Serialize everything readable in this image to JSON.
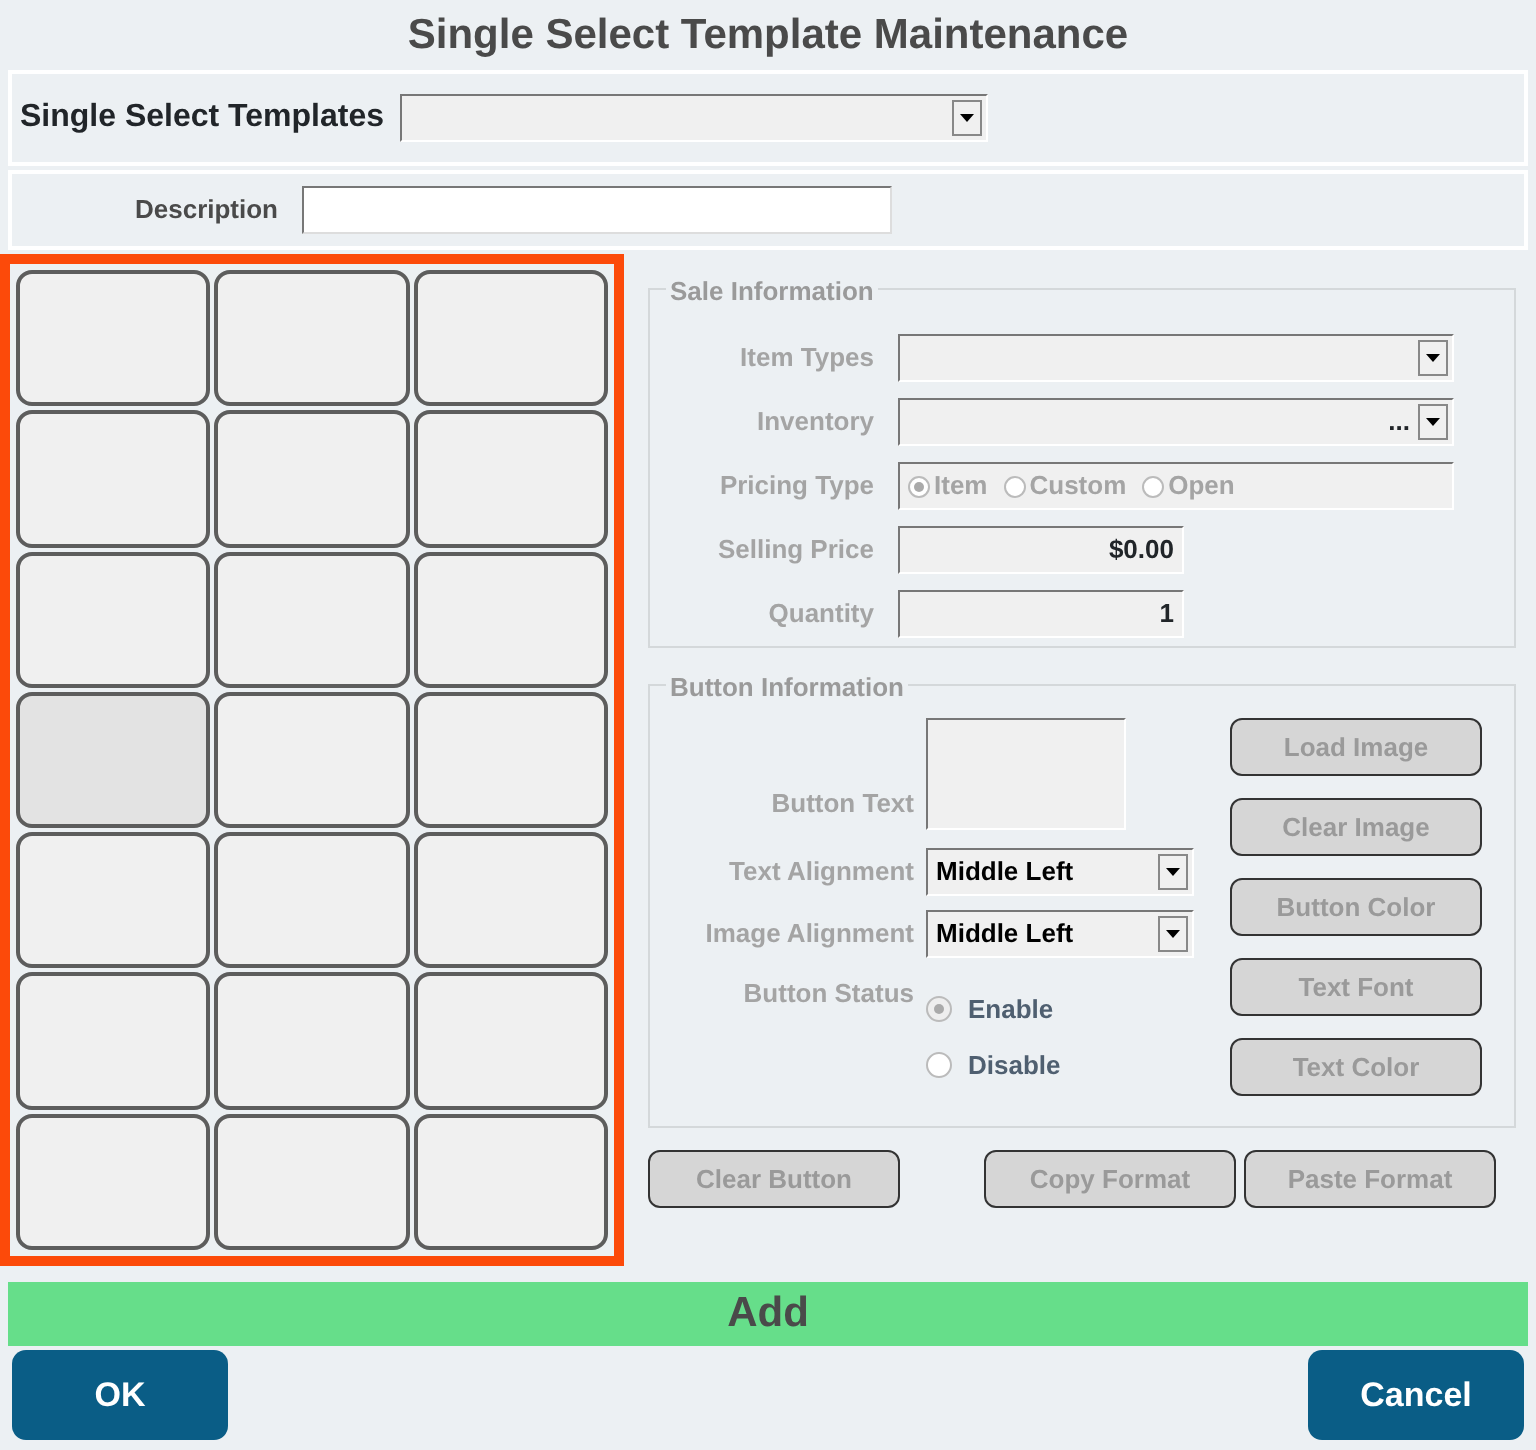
{
  "window": {
    "title": "Single Select Template Maintenance"
  },
  "template_picker": {
    "label": "Single Select Templates"
  },
  "description": {
    "label": "Description"
  },
  "button_grid": [
    {
      "selected": false
    },
    {
      "selected": false
    },
    {
      "selected": false
    },
    {
      "selected": false
    },
    {
      "selected": false
    },
    {
      "selected": false
    },
    {
      "selected": false
    },
    {
      "selected": false
    },
    {
      "selected": false
    },
    {
      "selected": true
    },
    {
      "selected": false
    },
    {
      "selected": false
    },
    {
      "selected": false
    },
    {
      "selected": false
    },
    {
      "selected": false
    },
    {
      "selected": false
    },
    {
      "selected": false
    },
    {
      "selected": false
    },
    {
      "selected": false
    },
    {
      "selected": false
    },
    {
      "selected": false
    }
  ],
  "sale_information": {
    "legend": "Sale Information",
    "item_types": {
      "label": "Item Types"
    },
    "inventory": {
      "label": "Inventory",
      "ellipsis": "..."
    },
    "pricing_type": {
      "label": "Pricing Type",
      "options": [
        {
          "label": "Item",
          "selected": true
        },
        {
          "label": "Custom",
          "selected": false
        },
        {
          "label": "Open",
          "selected": false
        }
      ]
    },
    "selling_price": {
      "label": "Selling Price",
      "value": "$0.00"
    },
    "quantity": {
      "label": "Quantity",
      "value": "1"
    }
  },
  "button_information": {
    "legend": "Button Information",
    "button_text": {
      "label": "Button Text"
    },
    "text_alignment": {
      "label": "Text Alignment",
      "value": "Middle Left"
    },
    "image_alignment": {
      "label": "Image Alignment",
      "value": "Middle Left"
    },
    "button_status": {
      "label": "Button Status",
      "options": [
        {
          "label": "Enable",
          "selected": true
        },
        {
          "label": "Disable",
          "selected": false
        }
      ]
    },
    "actions": [
      "Load Image",
      "Clear Image",
      "Button Color",
      "Text Font",
      "Text Color"
    ]
  },
  "format_buttons": [
    "Clear Button",
    "Copy Format",
    "Paste Format"
  ],
  "add_bar": {
    "label": "Add"
  },
  "footer_buttons": [
    "OK",
    "Cancel"
  ]
}
